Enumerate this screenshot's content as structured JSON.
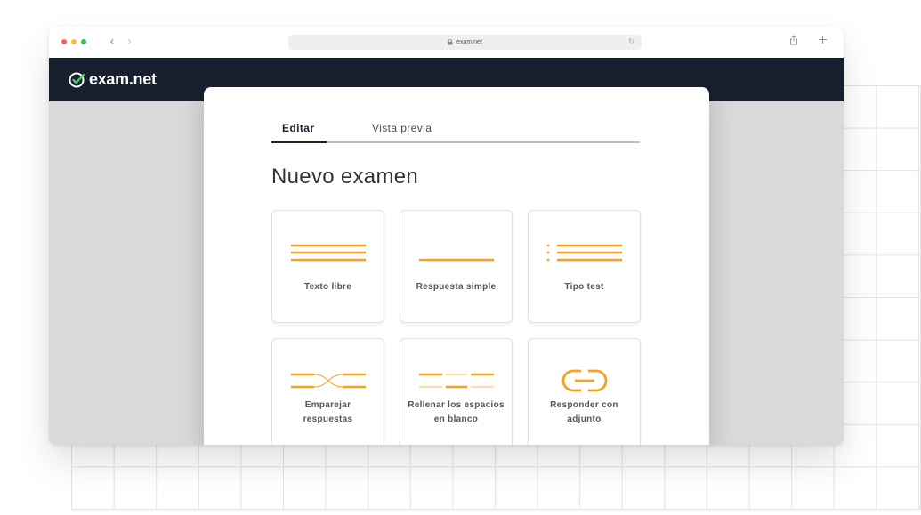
{
  "browser": {
    "url": "exam.net",
    "icons": {
      "back": "chevron-left-icon",
      "forward": "chevron-right-icon",
      "lock": "lock-icon",
      "reload": "reload-icon",
      "share": "share-icon",
      "new_tab": "plus-icon"
    }
  },
  "app": {
    "logo_text": "exam.net",
    "brand_color": "#17202e",
    "accent_color": "#f7a021"
  },
  "editor": {
    "tabs": [
      {
        "label": "Editar",
        "active": true
      },
      {
        "label": "Vista previa",
        "active": false
      }
    ],
    "title": "Nuevo examen",
    "question_types": [
      {
        "label": "Texto libre",
        "icon": "free-text-icon"
      },
      {
        "label": "Respuesta simple",
        "icon": "short-answer-icon"
      },
      {
        "label": "Tipo test",
        "icon": "multiple-choice-icon"
      },
      {
        "label": "Emparejar respuestas",
        "icon": "matching-icon"
      },
      {
        "label": "Rellenar los espacios en blanco",
        "icon": "fill-blanks-icon"
      },
      {
        "label": "Responder con adjunto",
        "icon": "attachment-link-icon"
      }
    ]
  }
}
